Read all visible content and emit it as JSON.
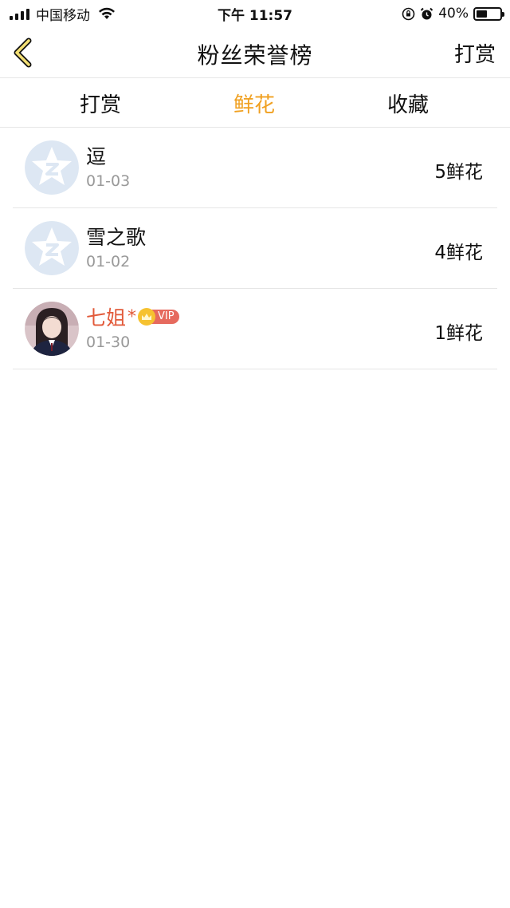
{
  "status_bar": {
    "carrier": "中国移动",
    "time": "下午 11:57",
    "battery_percent": "40%",
    "battery_level": 0.4
  },
  "nav": {
    "title": "粉丝荣誉榜",
    "right_action": "打赏"
  },
  "tabs": [
    {
      "label": "打赏",
      "active": false
    },
    {
      "label": "鲜花",
      "active": true
    },
    {
      "label": "收藏",
      "active": false
    }
  ],
  "colors": {
    "accent": "#f0a020",
    "vip_name": "#e25a3a",
    "vip_badge": "#e66a5e",
    "crown": "#f6c230",
    "default_avatar_bg": "#dde7f3"
  },
  "list": [
    {
      "name": "逗",
      "date": "01-03",
      "count": "5鲜花",
      "avatar": "default-qq-avatar",
      "vip": false
    },
    {
      "name": "雪之歌",
      "date": "01-02",
      "count": "4鲜花",
      "avatar": "default-qq-avatar",
      "vip": false
    },
    {
      "name": "七姐",
      "name_suffix": "*",
      "vip_label": "VIP",
      "date": "01-30",
      "count": "1鲜花",
      "avatar": "user-photo-avatar",
      "vip": true
    }
  ]
}
